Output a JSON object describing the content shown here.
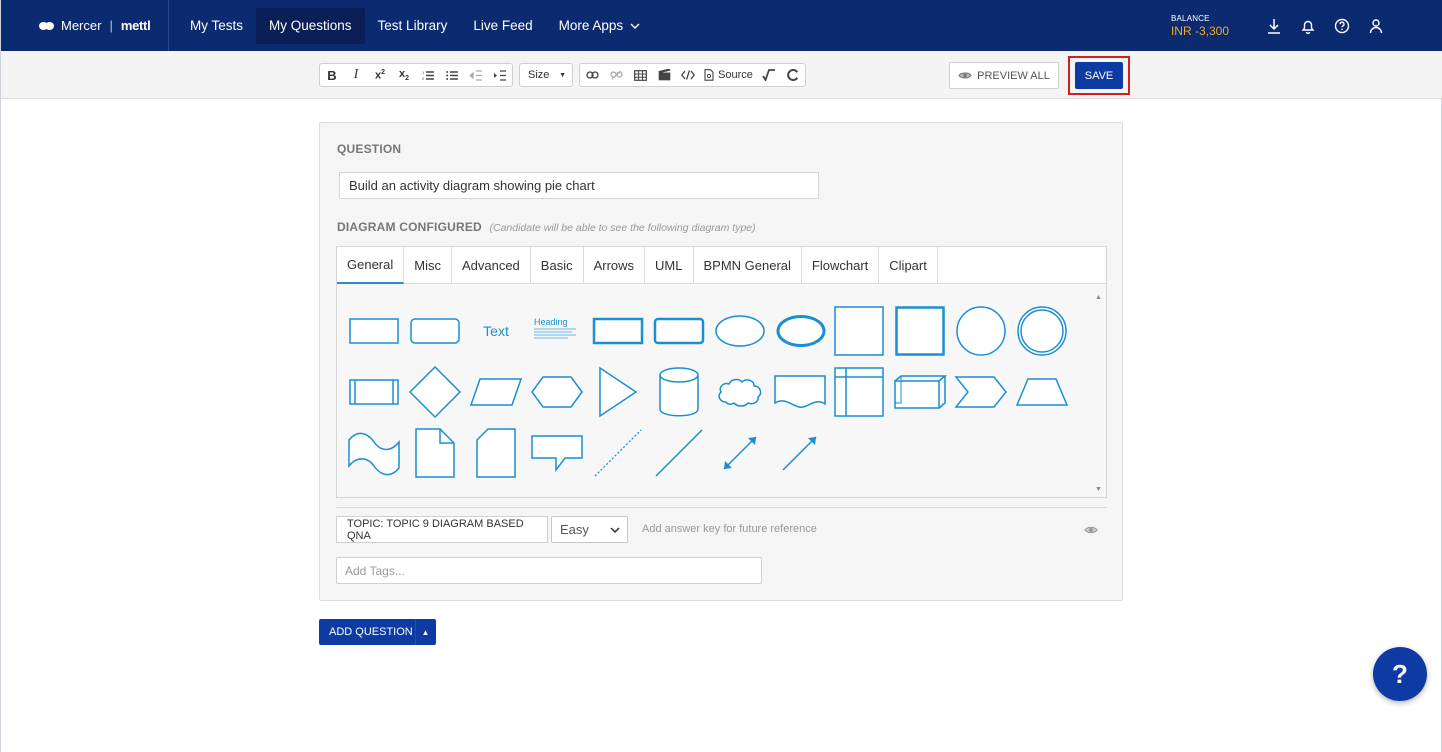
{
  "brand": {
    "name": "Mercer",
    "separator": "|",
    "product": "mettl"
  },
  "nav": {
    "items": [
      {
        "label": "My Tests"
      },
      {
        "label": "My Questions"
      },
      {
        "label": "Test Library"
      },
      {
        "label": "Live Feed"
      },
      {
        "label": "More Apps"
      }
    ],
    "active": "My Questions"
  },
  "balance": {
    "label": "BALANCE",
    "value": "INR -3,300"
  },
  "nav_icons": [
    "download-icon",
    "bell-icon",
    "help-circle-icon",
    "user-icon"
  ],
  "toolbar": {
    "size_label": "Size",
    "source_label": "Source",
    "preview_label": "PREVIEW ALL",
    "save_label": "SAVE"
  },
  "question": {
    "label": "QUESTION",
    "value": "Build an activity diagram showing pie chart"
  },
  "diagram": {
    "label": "DIAGRAM CONFIGURED",
    "hint": "(Candidate will be able to see the following diagram type)",
    "tabs": [
      "General",
      "Misc",
      "Advanced",
      "Basic",
      "Arrows",
      "UML",
      "BPMN General",
      "Flowchart",
      "Clipart"
    ],
    "active_tab": "General",
    "shape_text": "Text",
    "shape_heading": "Heading",
    "shape_color": "#1a8fd1"
  },
  "meta": {
    "topic": "TOPIC: TOPIC 9 DIAGRAM BASED QNA",
    "difficulty": "Easy",
    "answer_key": "Add answer key for future reference",
    "tags_placeholder": "Add Tags..."
  },
  "add_question_label": "ADD QUESTION",
  "help_label": "?",
  "colors": {
    "nav_bg": "#0b2a6f",
    "primary": "#0e3ba3",
    "balance": "#f5a623",
    "highlight": "#d21f1f"
  }
}
